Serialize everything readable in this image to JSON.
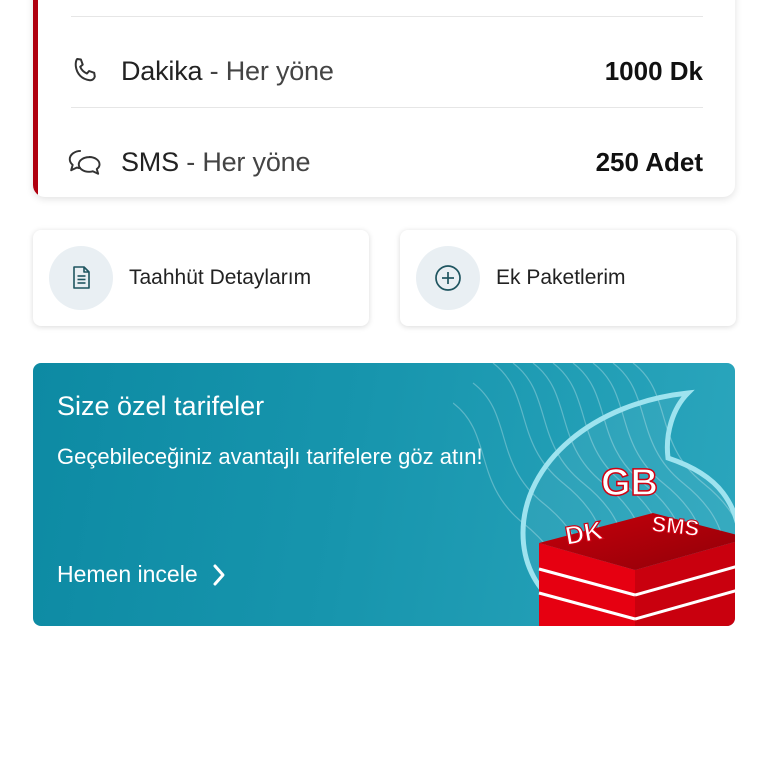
{
  "usage": {
    "rows": [
      {
        "icon": "phone-icon",
        "name": "Dakika",
        "scope": " - Her yöne",
        "value": "1000 Dk"
      },
      {
        "icon": "chat-bubbles-icon",
        "name": "SMS",
        "scope": " - Her yöne",
        "value": "250 Adet"
      }
    ],
    "accent_color": "#b0000f"
  },
  "quick_actions": [
    {
      "icon": "document-icon",
      "label": "Taahhüt Detaylarım"
    },
    {
      "icon": "add-circle-icon",
      "label": "Ek Paketlerim"
    }
  ],
  "promo": {
    "title": "Size özel tarifeler",
    "description": "Geçebileceğiniz avantajlı tarifelere göz atın!",
    "cta": "Hemen incele",
    "art_labels": {
      "gb": "GB",
      "dk": "DK",
      "sms": "SMS"
    },
    "background_color": "#1795ad"
  }
}
